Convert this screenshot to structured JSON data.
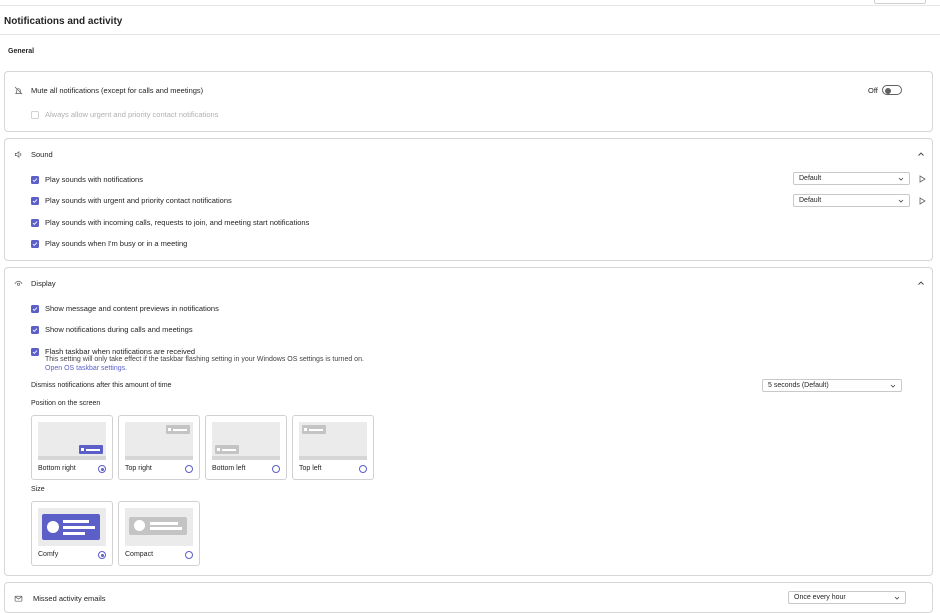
{
  "page": {
    "title": "Notifications and activity",
    "section": "General"
  },
  "mute": {
    "label": "Mute all notifications (except for calls and meetings)",
    "toggle_label": "Off",
    "sub_label": "Always allow urgent and priority contact notifications"
  },
  "sound": {
    "title": "Sound",
    "items": [
      {
        "label": "Play sounds with notifications",
        "select": "Default"
      },
      {
        "label": "Play sounds with urgent and priority contact notifications",
        "select": "Default"
      },
      {
        "label": "Play sounds with incoming calls, requests to join, and meeting start notifications"
      },
      {
        "label": "Play sounds when I'm busy or in a meeting"
      }
    ]
  },
  "display": {
    "title": "Display",
    "items": [
      {
        "label": "Show message and content previews in notifications"
      },
      {
        "label": "Show notifications during calls and meetings"
      },
      {
        "label": "Flash taskbar when notifications are received"
      }
    ],
    "flash_note": "This setting will only take effect if the taskbar flashing setting in your Windows OS settings is turned on.",
    "os_link": "Open OS taskbar settings.",
    "dismiss_label": "Dismiss notifications after this amount of time",
    "dismiss_value": "5 seconds (Default)",
    "position_label": "Position on the screen",
    "positions": [
      {
        "label": "Bottom right",
        "selected": true
      },
      {
        "label": "Top right",
        "selected": false
      },
      {
        "label": "Bottom left",
        "selected": false
      },
      {
        "label": "Top left",
        "selected": false
      }
    ],
    "size_label": "Size",
    "sizes": [
      {
        "label": "Comfy",
        "selected": true
      },
      {
        "label": "Compact",
        "selected": false
      }
    ]
  },
  "missed": {
    "label": "Missed activity emails",
    "value": "Once every hour"
  },
  "colors": {
    "accent": "#5b5fc7",
    "inactive_preview": "#c4c4c4",
    "border": "#d6d6d6"
  }
}
